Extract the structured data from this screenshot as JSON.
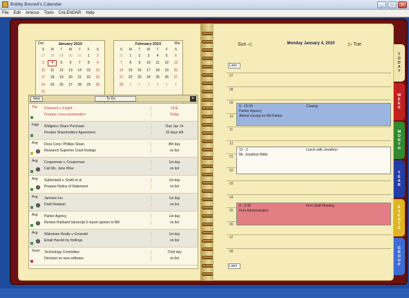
{
  "window": {
    "title": "Bobby Bosnell's Calendar",
    "min": "_",
    "max": "□",
    "close": "x"
  },
  "menu": [
    "File",
    "Edit",
    "Amicus",
    "Tools",
    "CALENDAR",
    "Help"
  ],
  "cal1": {
    "title": "January 2010",
    "prev": "Dec",
    "dows": [
      "S",
      "M",
      "T",
      "W",
      "T",
      "F",
      "S"
    ],
    "days": [
      [
        "27",
        "o"
      ],
      [
        "28",
        "o"
      ],
      [
        "29",
        "o"
      ],
      [
        "30",
        "o"
      ],
      [
        "31",
        "o"
      ],
      [
        "1",
        ""
      ],
      [
        "2",
        "w"
      ],
      [
        "3",
        "w"
      ],
      [
        "4",
        "s"
      ],
      [
        "5",
        ""
      ],
      [
        "6",
        ""
      ],
      [
        "7",
        ""
      ],
      [
        "8",
        ""
      ],
      [
        "9",
        "w"
      ],
      [
        "10",
        "w"
      ],
      [
        "11",
        ""
      ],
      [
        "12",
        ""
      ],
      [
        "13",
        ""
      ],
      [
        "14",
        ""
      ],
      [
        "15",
        ""
      ],
      [
        "16",
        "w"
      ],
      [
        "17",
        "w"
      ],
      [
        "18",
        ""
      ],
      [
        "19",
        ""
      ],
      [
        "20",
        ""
      ],
      [
        "21",
        ""
      ],
      [
        "22",
        ""
      ],
      [
        "23",
        "w"
      ],
      [
        "24",
        "w"
      ],
      [
        "25",
        ""
      ],
      [
        "26",
        ""
      ],
      [
        "27",
        ""
      ],
      [
        "28",
        ""
      ],
      [
        "29",
        ""
      ],
      [
        "30",
        "w"
      ],
      [
        "31",
        "w"
      ]
    ]
  },
  "cal2": {
    "title": "February 2010",
    "next": "Mar",
    "dows": [
      "S",
      "M",
      "T",
      "W",
      "T",
      "F",
      "S"
    ],
    "days": [
      [
        "31",
        "o"
      ],
      [
        "1",
        ""
      ],
      [
        "2",
        ""
      ],
      [
        "3",
        ""
      ],
      [
        "4",
        ""
      ],
      [
        "5",
        ""
      ],
      [
        "6",
        "w"
      ],
      [
        "7",
        "w"
      ],
      [
        "8",
        ""
      ],
      [
        "9",
        ""
      ],
      [
        "10",
        ""
      ],
      [
        "11",
        ""
      ],
      [
        "12",
        ""
      ],
      [
        "13",
        "w"
      ],
      [
        "14",
        "w"
      ],
      [
        "15",
        ""
      ],
      [
        "16",
        ""
      ],
      [
        "17",
        ""
      ],
      [
        "18",
        ""
      ],
      [
        "19",
        ""
      ],
      [
        "20",
        "w"
      ],
      [
        "21",
        "w"
      ],
      [
        "22",
        ""
      ],
      [
        "23",
        ""
      ],
      [
        "24",
        ""
      ],
      [
        "25",
        ""
      ],
      [
        "26",
        ""
      ],
      [
        "27",
        "w"
      ],
      [
        "28",
        "w"
      ],
      [
        "1",
        "o"
      ],
      [
        "2",
        "o"
      ],
      [
        "3",
        "o"
      ],
      [
        "4",
        "o"
      ],
      [
        "5",
        "o"
      ],
      [
        "6",
        "o"
      ]
    ]
  },
  "todo": {
    "new": "New",
    "filter": "To Do",
    "items": [
      {
        "p": "Top",
        "a": "Diamond v. Knight",
        "b": "Prepare cross-examination",
        "d1": "DUE",
        "d2": "Today",
        "red": true,
        "mk": "green",
        "glyph": false
      },
      {
        "p": "High",
        "a": "Widgetco Share Purchase",
        "b": "Finalize Shareholders Agreement",
        "d1": "Due Jan 14",
        "d2": "10 days left",
        "red": false,
        "mk": "green",
        "glyph": false
      },
      {
        "p": "Avg",
        "a": "Doss Corp / Phillips Sloan",
        "b": "Research Supreme Court Rulings",
        "d1": "8th day",
        "d2": "on list",
        "red": false,
        "mk": "yellow",
        "glyph": true
      },
      {
        "p": "Avg",
        "a": "Cooperman v. Cooperman",
        "b": "Call Ms. Jane Wise",
        "d1": "1st day",
        "d2": "on list",
        "red": false,
        "mk": "green",
        "glyph": true
      },
      {
        "p": "Avg",
        "a": "Sutherland v. Smith et al",
        "b": "Prepare Notice of Statement",
        "d1": "1st day",
        "d2": "on list",
        "red": false,
        "mk": "green",
        "glyph": true
      },
      {
        "p": "Avg",
        "a": "Jamison Inc.",
        "b": "Draft Retainer",
        "d1": "1st day",
        "d2": "on list",
        "red": false,
        "mk": "green",
        "glyph": true
      },
      {
        "p": "Avg",
        "a": "Parker Agency",
        "b": "Review Hubbard transcript 3 report opinion to Bill",
        "d1": "1st day",
        "d2": "on list",
        "red": false,
        "mk": "green",
        "glyph": true
      },
      {
        "p": "Avg",
        "a": "Wakeham Realty v. Emerald",
        "b": "Email Harold my findings",
        "d1": "1st day",
        "d2": "on list",
        "red": false,
        "mk": "green",
        "glyph": true
      },
      {
        "p": "Soon",
        "a": "Technology Committee",
        "b": "Decision on new software",
        "d1": "72nd day",
        "d2": "on list",
        "red": false,
        "mk": "red",
        "glyph": false
      }
    ]
  },
  "day": {
    "prev": "Sun",
    "next": "Tue",
    "title": "Monday January 4, 2010",
    "later": "Later",
    "hours": [
      "07",
      "08",
      "09",
      "10",
      "11",
      "12",
      "01",
      "02",
      "03",
      "04",
      "05",
      "06",
      "07",
      "08"
    ],
    "appts": [
      {
        "time": "9 - 10:30",
        "name": "Closing",
        "l1": "Parker Agency",
        "l2": "Attend closing for Bill Parker",
        "color": "#9bb5e0"
      },
      {
        "time": "12 - 2",
        "name": "Lunch with Jonathon",
        "l1": "Mr. Jonathon Bittle",
        "l2": "",
        "color": "#fbf9f0"
      },
      {
        "time": "4 - 5:30",
        "name": "Firm Staff Meeting",
        "l1": "Firm Administration",
        "l2": "",
        "color": "#e27f84"
      }
    ]
  },
  "tabs": [
    {
      "label": "TODAY",
      "color": "#f1e7ad",
      "text": "#333"
    },
    {
      "label": "WEEK",
      "color": "#c41e1e",
      "text": "#fff"
    },
    {
      "label": "MONTH",
      "color": "#2e8b2e",
      "text": "#fff"
    },
    {
      "label": "YEAR",
      "color": "#1f3fa6",
      "text": "#fff"
    },
    {
      "label": "EVENTS",
      "color": "#e0b520",
      "text": "#fff"
    },
    {
      "label": "GROUP",
      "color": "#3a6ed6",
      "text": "#fff"
    }
  ]
}
